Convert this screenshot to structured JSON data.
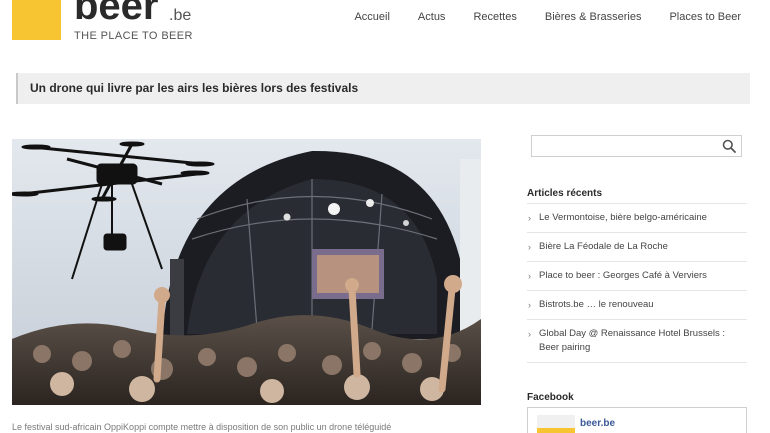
{
  "header": {
    "logo_word": "beer",
    "logo_tld": ".be",
    "tagline": "THE PLACE TO BEER",
    "brand_color": "#f7c531"
  },
  "nav": {
    "items": [
      {
        "label": "Accueil"
      },
      {
        "label": "Actus"
      },
      {
        "label": "Recettes"
      },
      {
        "label": "Bières & Brasseries"
      },
      {
        "label": "Places to Beer"
      }
    ]
  },
  "article": {
    "title": "Un drone qui livre par les airs les bières lors des festivals",
    "image_icon": "drone-concert-photo",
    "caption": "Le festival sud-africain OppiKoppi compte mettre à disposition de son public un drone téléguidé"
  },
  "sidebar": {
    "search": {
      "value": "",
      "placeholder": "",
      "icon": "search-icon"
    },
    "recent": {
      "title": "Articles récents",
      "items": [
        {
          "label": "Le Vermontoise, bière belgo-américaine"
        },
        {
          "label": "Bière La Féodale de La Roche"
        },
        {
          "label": "Place to beer : Georges Café à Verviers"
        },
        {
          "label": "Bistrots.be … le renouveau"
        },
        {
          "label": "Global Day @ Renaissance Hotel Brussels : Beer pairing"
        }
      ]
    },
    "facebook": {
      "title": "Facebook",
      "page_name": "beer.be",
      "link_color": "#3b5998"
    }
  }
}
